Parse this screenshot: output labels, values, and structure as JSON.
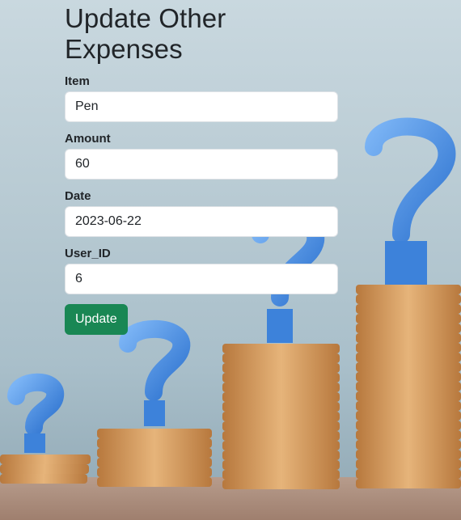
{
  "page": {
    "title": "Update Other Expenses"
  },
  "form": {
    "fields": [
      {
        "label": "Item",
        "value": "Pen"
      },
      {
        "label": "Amount",
        "value": "60"
      },
      {
        "label": "Date",
        "value": "2023-06-22"
      },
      {
        "label": "User_ID",
        "value": "6"
      }
    ],
    "submit_label": "Update"
  },
  "colors": {
    "button": "#198754",
    "title_text": "#212529",
    "question_mark": "#4a8fe0",
    "coin": "#d79a55"
  },
  "background": {
    "image_subject": "stacks-of-coins-with-question-marks"
  }
}
